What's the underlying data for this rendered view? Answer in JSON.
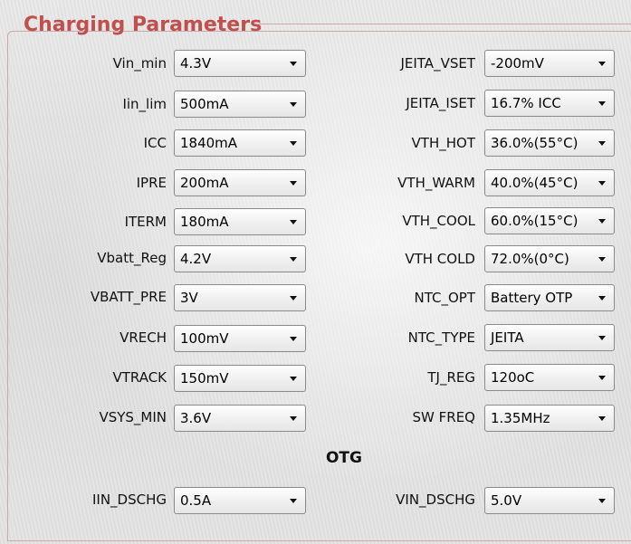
{
  "title": "Charging Parameters",
  "left_params": [
    {
      "label": "Vin_min",
      "value": "4.3V"
    },
    {
      "label": "Iin_lim",
      "value": "500mA"
    },
    {
      "label": "ICC",
      "value": "1840mA"
    },
    {
      "label": "IPRE",
      "value": "200mA"
    },
    {
      "label": "ITERM",
      "value": "180mA"
    },
    {
      "label": "Vbatt_Reg",
      "value": "4.2V"
    },
    {
      "label": "VBATT_PRE",
      "value": "3V"
    },
    {
      "label": "VRECH",
      "value": "100mV"
    },
    {
      "label": "VTRACK",
      "value": "150mV"
    },
    {
      "label": "VSYS_MIN",
      "value": "3.6V"
    }
  ],
  "right_params": [
    {
      "label": "JEITA_VSET",
      "value": "-200mV"
    },
    {
      "label": "JEITA_ISET",
      "value": "16.7% ICC"
    },
    {
      "label": "VTH_HOT",
      "value": "36.0%(55°C)"
    },
    {
      "label": "VTH_WARM",
      "value": "40.0%(45°C)"
    },
    {
      "label": "VTH_COOL",
      "value": "60.0%(15°C)"
    },
    {
      "label": "VTH  COLD",
      "value": "72.0%(0°C)"
    },
    {
      "label": "NTC_OPT",
      "value": "Battery OTP"
    },
    {
      "label": "NTC_TYPE",
      "value": "JEITA"
    },
    {
      "label": "TJ_REG",
      "value": "120oC"
    },
    {
      "label": "SW FREQ",
      "value": "1.35MHz"
    }
  ],
  "otg": {
    "heading": "OTG",
    "left": {
      "label": "IIN_DSCHG",
      "value": "0.5A"
    },
    "right": {
      "label": "VIN_DSCHG",
      "value": "5.0V"
    }
  },
  "colors": {
    "title": "#c0504d",
    "frame": "#c9a9a9"
  }
}
